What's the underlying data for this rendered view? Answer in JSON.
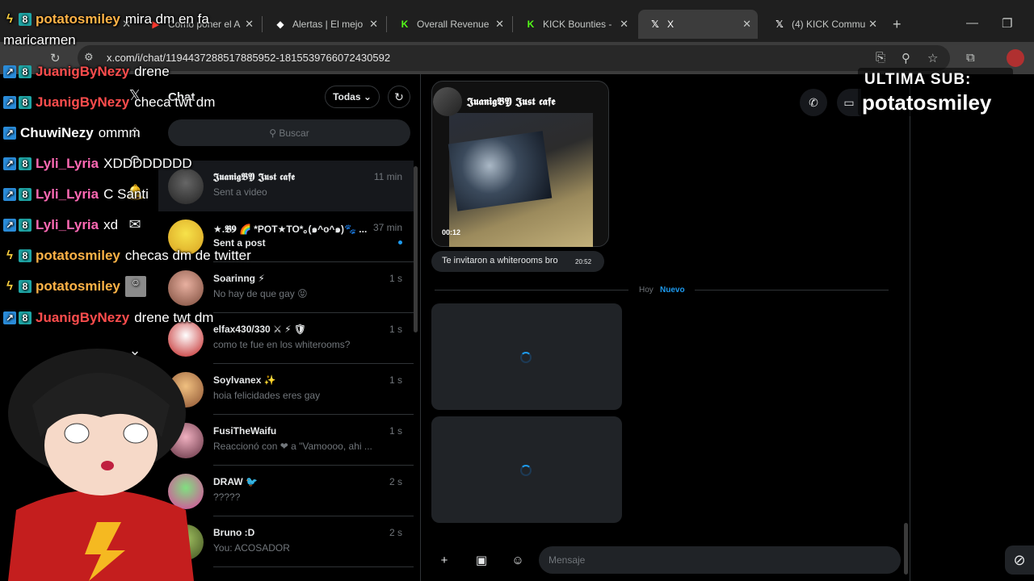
{
  "browser": {
    "tabs": [
      {
        "title": "",
        "icon": "twitch-icon"
      },
      {
        "title": "Como poner el A",
        "icon": "youtube-icon"
      },
      {
        "title": "Alertas | El mejo",
        "icon": "alert-icon"
      },
      {
        "title": "Overall Revenue",
        "icon": "kick-icon"
      },
      {
        "title": "KICK Bounties -",
        "icon": "kick-icon"
      },
      {
        "title": "X",
        "icon": "x-icon"
      },
      {
        "title": "(4) KICK Commu",
        "icon": "x-icon"
      }
    ],
    "url": "x.com/i/chat/1194437288517885952-1815539766072430592"
  },
  "x_chat": {
    "title": "Chat",
    "filter": "Todas",
    "search_placeholder": "Buscar",
    "conversations": [
      {
        "name": "𝕵𝖚𝖆𝖓𝖎𝖌𝕭𝖄 𝕵𝖚𝖘𝖙 𝖈𝖆𝖋𝖊",
        "time": "11 min",
        "preview": "Sent a video"
      },
      {
        "name": "★.𝕭𝟗 🌈 *POT★TO*｡(๑^o^๑)🐾 ...",
        "time": "37 min",
        "preview": "Sent a post"
      },
      {
        "name": "Soarinng ⚡",
        "time": "1 s",
        "preview": "No hay de que gay 😝"
      },
      {
        "name": "elfax430/330 ⚔ ⚡ 🛡",
        "time": "1 s",
        "preview": "como te fue en los whiterooms?"
      },
      {
        "name": "Soylvanex ✨",
        "time": "1 s",
        "preview": "hoia felicidades eres gay"
      },
      {
        "name": "FusiTheWaifu",
        "time": "1 s",
        "preview": "Reaccionó con ❤ a \"Vamoooo, ahi ..."
      },
      {
        "name": "DRAW 🐦",
        "time": "2 s",
        "preview": "?????"
      },
      {
        "name": "Bruno :D",
        "time": "2 s",
        "preview": "You: ACOSADOR"
      }
    ],
    "thread": {
      "header_name": "𝕵𝖚𝖆𝖓𝖎𝖌𝕭𝖄 𝕵𝖚𝖘𝖙 𝖈𝖆𝖋𝖊",
      "video_duration": "00:12",
      "message": "Te invitaron a whiterooms bro",
      "message_time": "20:52",
      "day_label": "Hoy",
      "new_label": "Nuevo",
      "input_placeholder": "Mensaje"
    }
  },
  "overlay": {
    "top_text": "maricarmen",
    "chat": [
      {
        "user": "potatosmiley",
        "msg": "mira dm en fa",
        "color": "#ffb347",
        "badges": [
          "bolt",
          "teal"
        ]
      },
      {
        "user": "JuanigByNezy",
        "msg": "drene",
        "color": "#ff4d4d",
        "badges": [
          "blue",
          "teal"
        ]
      },
      {
        "user": "JuanigByNezy",
        "msg": "checa twt dm",
        "color": "#ff4d4d",
        "badges": [
          "blue",
          "teal"
        ]
      },
      {
        "user": "ChuwiNezy",
        "msg": "ommm",
        "color": "#ffffff",
        "badges": [
          "blue"
        ]
      },
      {
        "user": "Lyli_Lyria",
        "msg": "XDDDDDDDD",
        "color": "#ff69b4",
        "badges": [
          "blue",
          "teal"
        ]
      },
      {
        "user": "Lyli_Lyria",
        "msg": "C Santi",
        "color": "#ff69b4",
        "badges": [
          "blue",
          "teal"
        ]
      },
      {
        "user": "Lyli_Lyria",
        "msg": "xd",
        "color": "#ff69b4",
        "badges": [
          "blue",
          "teal"
        ]
      },
      {
        "user": "potatosmiley",
        "msg": "checas dm de twitter",
        "color": "#ffb347",
        "badges": [
          "bolt",
          "teal"
        ]
      },
      {
        "user": "potatosmiley",
        "msg": "",
        "color": "#ffb347",
        "badges": [
          "bolt",
          "teal"
        ]
      },
      {
        "user": "JuanigByNezy",
        "msg": "drene twt dm",
        "color": "#ff4d4d",
        "badges": [
          "blue",
          "teal"
        ]
      }
    ],
    "sub_label": "ULTIMA SUB:",
    "sub_name": "potatosmiley"
  }
}
